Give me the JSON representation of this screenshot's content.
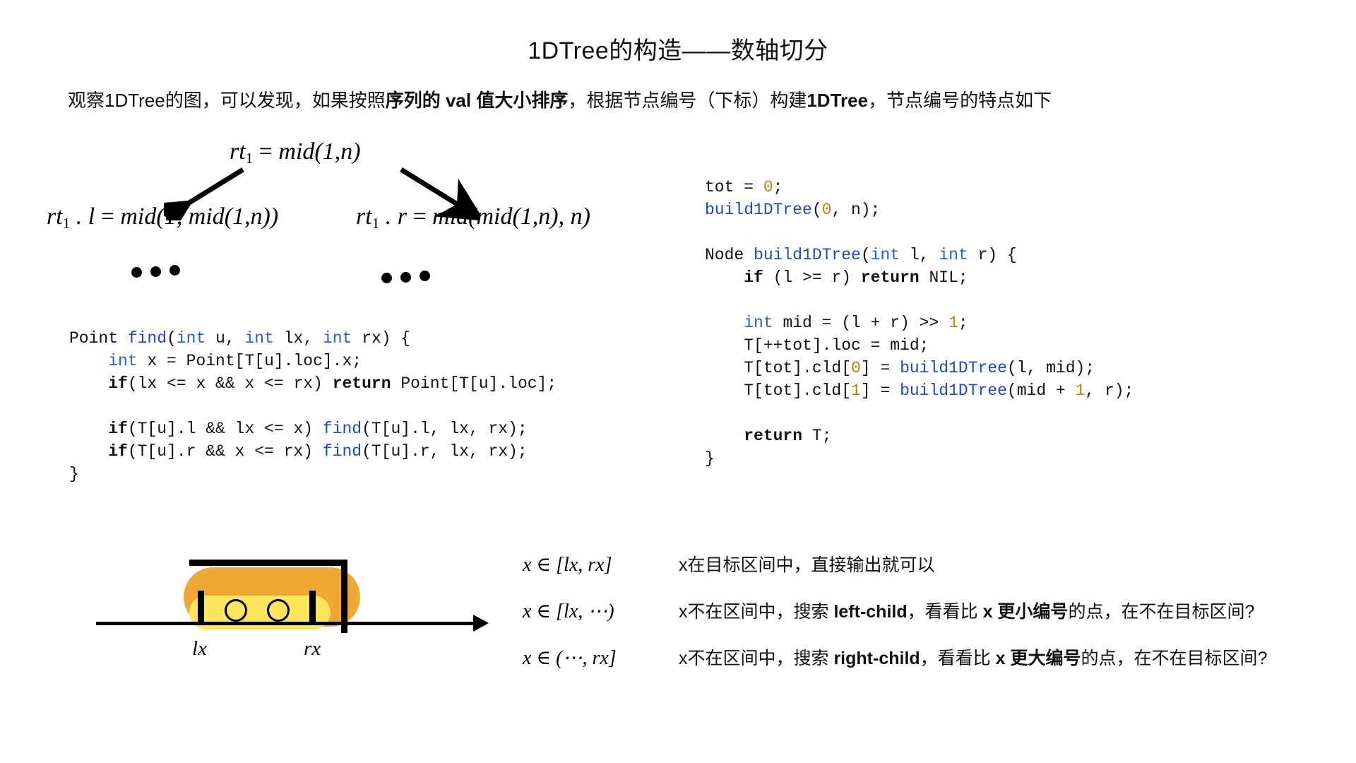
{
  "title": "1DTree的构造——数轴切分",
  "subtitle": {
    "part1": "观察1DTree的图，可以发现，如果按照",
    "bold1": "序列的 val 值大小排序",
    "part2": "，根据节点编号（下标）构建",
    "bold2": "1DTree",
    "part3": "，节点编号的特点如下"
  },
  "tree": {
    "root": {
      "lhs": "rt",
      "sub": "1",
      "eq": " = ",
      "rhs": "mid(1,n)"
    },
    "left": {
      "lhs": "rt",
      "sub": "1",
      "member": " . l",
      "eq": " = ",
      "rhs": "mid(1, mid(1,n))"
    },
    "right": {
      "lhs": "rt",
      "sub": "1",
      "member": " . r",
      "eq": " = ",
      "rhs": "mid(mid(1,n), n)"
    },
    "ellipsis": "• • •"
  },
  "code_left": {
    "lines": [
      [
        {
          "t": "Point ",
          "c": "plain"
        },
        {
          "t": "find",
          "c": "fn"
        },
        {
          "t": "(",
          "c": "plain"
        },
        {
          "t": "int",
          "c": "ty"
        },
        {
          "t": " u, ",
          "c": "plain"
        },
        {
          "t": "int",
          "c": "ty"
        },
        {
          "t": " lx, ",
          "c": "plain"
        },
        {
          "t": "int",
          "c": "ty"
        },
        {
          "t": " rx) {",
          "c": "plain"
        }
      ],
      [
        {
          "t": "    ",
          "c": "plain"
        },
        {
          "t": "int",
          "c": "ty"
        },
        {
          "t": " x = Point[T[u].loc].x;",
          "c": "plain"
        }
      ],
      [
        {
          "t": "    ",
          "c": "plain"
        },
        {
          "t": "if",
          "c": "kw"
        },
        {
          "t": "(lx <= x && x <= rx) ",
          "c": "plain"
        },
        {
          "t": "return",
          "c": "kw"
        },
        {
          "t": " Point[T[u].loc];",
          "c": "plain"
        }
      ],
      [
        {
          "t": "",
          "c": "plain"
        }
      ],
      [
        {
          "t": "    ",
          "c": "plain"
        },
        {
          "t": "if",
          "c": "kw"
        },
        {
          "t": "(T[u].l && lx <= x) ",
          "c": "plain"
        },
        {
          "t": "find",
          "c": "fn"
        },
        {
          "t": "(T[u].l, lx, rx);",
          "c": "plain"
        }
      ],
      [
        {
          "t": "    ",
          "c": "plain"
        },
        {
          "t": "if",
          "c": "kw"
        },
        {
          "t": "(T[u].r && x <= rx) ",
          "c": "plain"
        },
        {
          "t": "find",
          "c": "fn"
        },
        {
          "t": "(T[u].r, lx, rx);",
          "c": "plain"
        }
      ],
      [
        {
          "t": "}",
          "c": "plain"
        }
      ]
    ]
  },
  "code_right": {
    "lines": [
      [
        {
          "t": "tot = ",
          "c": "plain"
        },
        {
          "t": "0",
          "c": "num"
        },
        {
          "t": ";",
          "c": "plain"
        }
      ],
      [
        {
          "t": "build1DTree",
          "c": "fn"
        },
        {
          "t": "(",
          "c": "plain"
        },
        {
          "t": "0",
          "c": "num"
        },
        {
          "t": ", n);",
          "c": "plain"
        }
      ],
      [
        {
          "t": "",
          "c": "plain"
        }
      ],
      [
        {
          "t": "Node ",
          "c": "plain"
        },
        {
          "t": "build1DTree",
          "c": "fn"
        },
        {
          "t": "(",
          "c": "plain"
        },
        {
          "t": "int",
          "c": "ty"
        },
        {
          "t": " l, ",
          "c": "plain"
        },
        {
          "t": "int",
          "c": "ty"
        },
        {
          "t": " r) {",
          "c": "plain"
        }
      ],
      [
        {
          "t": "    ",
          "c": "plain"
        },
        {
          "t": "if",
          "c": "kw"
        },
        {
          "t": " (l >= r) ",
          "c": "plain"
        },
        {
          "t": "return",
          "c": "kw"
        },
        {
          "t": " NIL;",
          "c": "plain"
        }
      ],
      [
        {
          "t": "",
          "c": "plain"
        }
      ],
      [
        {
          "t": "    ",
          "c": "plain"
        },
        {
          "t": "int",
          "c": "ty"
        },
        {
          "t": " mid = (l + r) >> ",
          "c": "plain"
        },
        {
          "t": "1",
          "c": "num"
        },
        {
          "t": ";",
          "c": "plain"
        }
      ],
      [
        {
          "t": "    T[++tot].loc = mid;",
          "c": "plain"
        }
      ],
      [
        {
          "t": "    T[tot].cld[",
          "c": "plain"
        },
        {
          "t": "0",
          "c": "num"
        },
        {
          "t": "] = ",
          "c": "plain"
        },
        {
          "t": "build1DTree",
          "c": "fn"
        },
        {
          "t": "(l, mid);",
          "c": "plain"
        }
      ],
      [
        {
          "t": "    T[tot].cld[",
          "c": "plain"
        },
        {
          "t": "1",
          "c": "num"
        },
        {
          "t": "] = ",
          "c": "plain"
        },
        {
          "t": "build1DTree",
          "c": "fn"
        },
        {
          "t": "(mid + ",
          "c": "plain"
        },
        {
          "t": "1",
          "c": "num"
        },
        {
          "t": ", r);",
          "c": "plain"
        }
      ],
      [
        {
          "t": "",
          "c": "plain"
        }
      ],
      [
        {
          "t": "    ",
          "c": "plain"
        },
        {
          "t": "return",
          "c": "kw"
        },
        {
          "t": " T;",
          "c": "plain"
        }
      ],
      [
        {
          "t": "}",
          "c": "plain"
        }
      ]
    ]
  },
  "figure": {
    "label_lx": "lx",
    "label_rx": "rx",
    "colors": {
      "band_outer": "#efa833",
      "band_inner": "#fde65c",
      "stroke": "#000000"
    },
    "node_count": 2
  },
  "explain": {
    "rows": [
      {
        "cond": "x ∈ [lx, rx]",
        "pre": "x在目标区间中，直接输出就可以",
        "bold": "",
        "post": ""
      },
      {
        "cond": "x ∈ [lx, ⋯)",
        "pre": "x不在区间中，搜索 ",
        "bold": "left-child",
        "mid": "，看看比 ",
        "bold2": "x 更小编号",
        "post": "的点，在不在目标区间?"
      },
      {
        "cond": "x ∈ (⋯, rx]",
        "pre": "x不在区间中，搜索 ",
        "bold": "right-child",
        "mid": "，看看比 ",
        "bold2": "x 更大编号",
        "post": "的点，在不在目标区间?"
      }
    ]
  }
}
